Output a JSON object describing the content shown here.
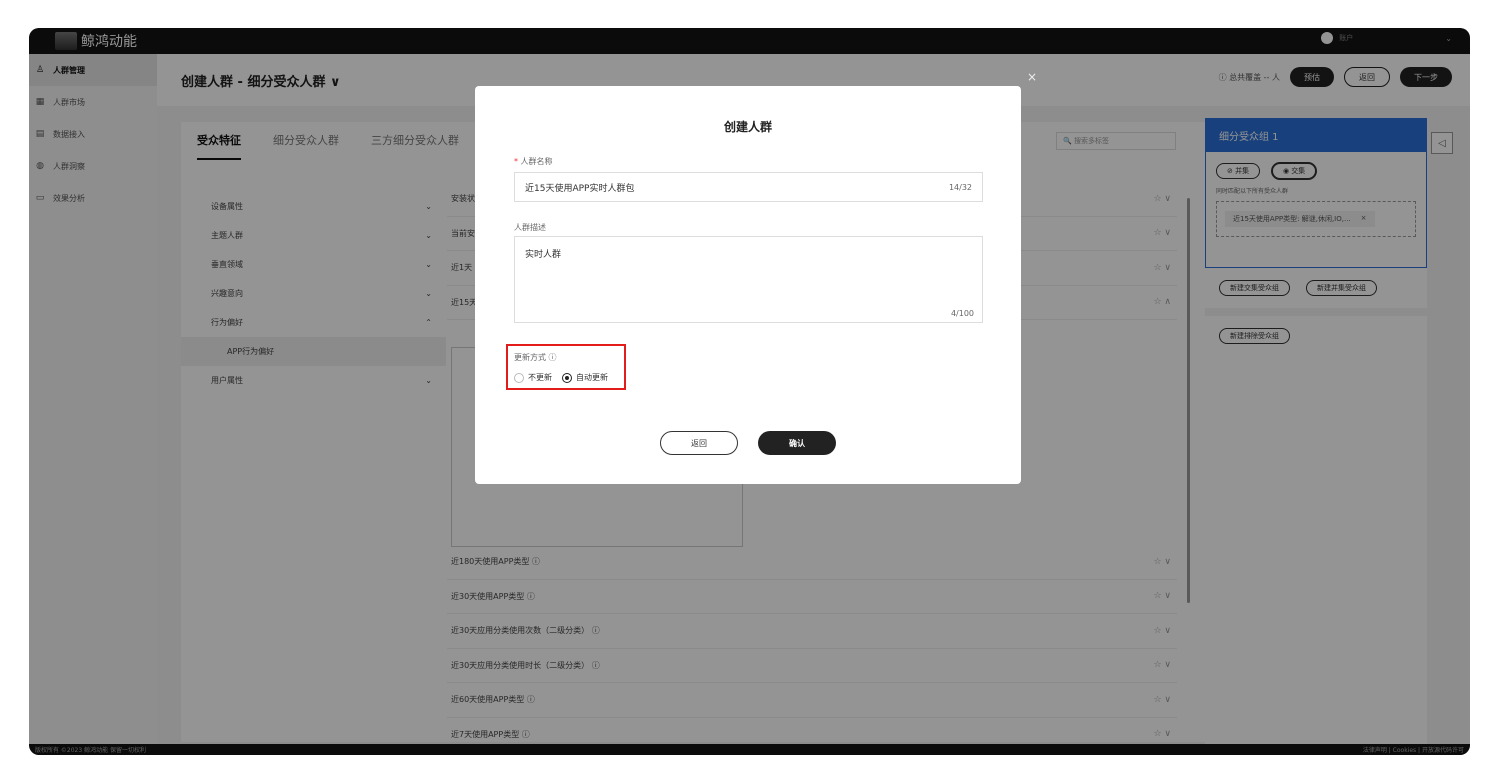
{
  "app": {
    "brand": "鲸鸿动能",
    "user_chevron": "⌄",
    "user_name": "账户"
  },
  "sidebar": {
    "items": [
      {
        "icon": "person-icon",
        "glyph": "♙",
        "label": "人群管理",
        "active": true
      },
      {
        "icon": "market-icon",
        "glyph": "▦",
        "label": "人群市场"
      },
      {
        "icon": "data-icon",
        "glyph": "▤",
        "label": "数据接入"
      },
      {
        "icon": "insight-icon",
        "glyph": "◍",
        "label": "人群洞察"
      },
      {
        "icon": "analysis-icon",
        "glyph": "▭",
        "label": "效果分析"
      }
    ]
  },
  "header": {
    "title": "创建人群 - 细分受众人群 ∨",
    "hint": "ⓘ 总共覆盖 -- 人",
    "estimate": "预估",
    "back": "返回",
    "next": "下一步"
  },
  "content": {
    "tabs": [
      "受众特征",
      "细分受众人群",
      "三方细分受众人群"
    ],
    "search_placeholder": "🔍 搜索多标签",
    "categories": [
      {
        "label": "设备属性",
        "chev": "⌄"
      },
      {
        "label": "主题人群",
        "chev": "⌄"
      },
      {
        "label": "垂直领域",
        "chev": "⌄"
      },
      {
        "label": "兴趣意向",
        "chev": "⌄"
      },
      {
        "label": "行为偏好",
        "chev": "⌃"
      },
      {
        "label": "APP行为偏好",
        "chev": "",
        "sub": true
      },
      {
        "label": "用户属性",
        "chev": "⌄"
      }
    ],
    "rows_top": [
      {
        "label": "安装状",
        "ops": "☆ ∨"
      },
      {
        "label": "当前安",
        "ops": "☆ ∨"
      },
      {
        "label": "近1天",
        "ops": "☆ ∨"
      },
      {
        "label": "近15天",
        "ops": "☆ ∧"
      }
    ],
    "rows_bottom": [
      {
        "label": "近180天使用APP类型 ⓘ",
        "ops": "☆ ∨"
      },
      {
        "label": "近30天使用APP类型 ⓘ",
        "ops": "☆ ∨"
      },
      {
        "label": "近30天应用分类使用次数（二级分类） ⓘ",
        "ops": "☆ ∨"
      },
      {
        "label": "近30天应用分类使用时长（二级分类） ⓘ",
        "ops": "☆ ∨"
      },
      {
        "label": "近60天使用APP类型 ⓘ",
        "ops": "☆ ∨"
      },
      {
        "label": "近7天使用APP类型 ⓘ",
        "ops": "☆ ∨"
      }
    ]
  },
  "rpanel": {
    "title": "细分受众组 1",
    "union": "⊘ 并集",
    "intersect": "◉ 交集",
    "note": "同时匹配以下所有受众人群",
    "tag": "近15天使用APP类型: 解谜,休闲,IO,...",
    "tag_close": "×",
    "new_intersect": "新建交集受众组",
    "new_union": "新建并集受众组",
    "new_exclude": "新建排除受众组",
    "close": "◁"
  },
  "footer": {
    "left": "版权所有 ©2023 鲸鸿动能 保留一切权利",
    "right": "法律声明 | Cookies | 开放源代码许可"
  },
  "modal": {
    "title": "创建人群",
    "close": "×",
    "name_label": "人群名称",
    "required": "*",
    "name_value": "近15天使用APP实时人群包",
    "name_count": "14/32",
    "desc_label": "人群描述",
    "desc_value": "实时人群",
    "desc_count": "4/100",
    "update_label": "更新方式 ⓘ",
    "opt_no": "不更新",
    "opt_auto": "自动更新",
    "selected": "auto",
    "back": "返回",
    "confirm": "确认"
  }
}
